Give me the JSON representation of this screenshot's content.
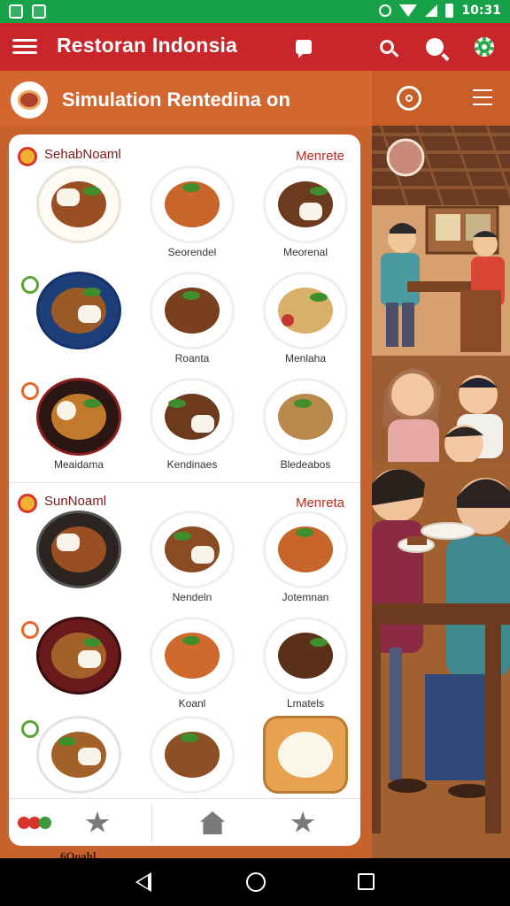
{
  "status_bar": {
    "time": "10:31"
  },
  "app_bar": {
    "title": "Restoran Indonsia"
  },
  "sub_header": {
    "title": "Simulation Rentedina  on"
  },
  "sections": [
    {
      "left_label": "SehabNoaml",
      "right_label": "Menrete",
      "rows": [
        [
          {
            "name": ""
          },
          {
            "name": "Seorendel"
          },
          {
            "name": "Meorenal"
          }
        ],
        [
          {
            "name": ""
          },
          {
            "name": "Roanta"
          },
          {
            "name": "Menlaha"
          }
        ],
        [
          {
            "name": "Meaidama"
          },
          {
            "name": "Kendinaes"
          },
          {
            "name": "Bledeabos"
          }
        ]
      ]
    },
    {
      "left_label": "SunNoaml",
      "right_label": "Menreta",
      "rows": [
        [
          {
            "name": ""
          },
          {
            "name": "Nendeln"
          },
          {
            "name": "Jotemnan"
          }
        ],
        [
          {
            "name": ""
          },
          {
            "name": "Koanl"
          },
          {
            "name": "Lmatels"
          }
        ],
        [
          {
            "name": ""
          },
          {
            "name": ""
          },
          {
            "name": ""
          }
        ]
      ]
    }
  ],
  "below_card_text": "6Ooahl",
  "colors": {
    "status_bar": "#17a24a",
    "app_bar": "#c8262a",
    "accent_orange": "#d4672f",
    "card": "#ffffff"
  },
  "icons": {
    "app_bar": [
      "menu-icon",
      "chat-icon",
      "search-icon",
      "search-filled-icon",
      "settings-icon"
    ],
    "sub_header": [
      "logo-icon",
      "target-icon",
      "list-icon"
    ],
    "tab_bar": [
      "flower-icon",
      "star-icon",
      "home-icon",
      "star-icon"
    ],
    "nav_bar": [
      "back-icon",
      "home-circle-icon",
      "recents-icon"
    ]
  }
}
